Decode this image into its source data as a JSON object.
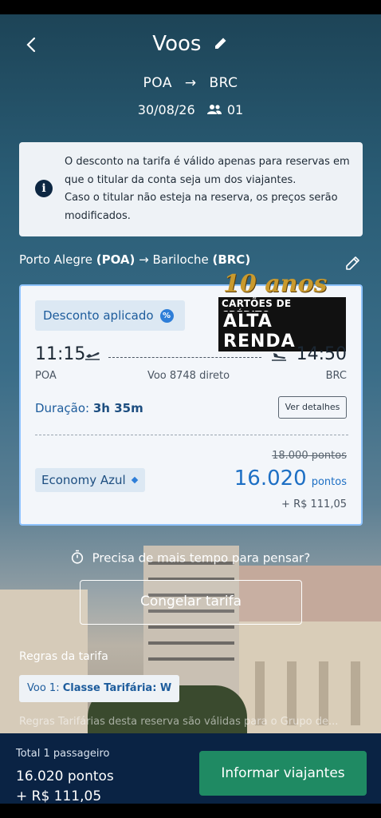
{
  "header": {
    "title": "Voos",
    "origin": "POA",
    "destination": "BRC",
    "date": "30/08/26",
    "passengers": "01"
  },
  "info": {
    "line1": "O desconto na tarifa é válido apenas para reservas em que o titular da conta seja um dos viajantes.",
    "line2": "Caso o titular não esteja na reserva, os preços serão modificados.",
    "icon": "info-icon"
  },
  "route_line": {
    "origin_city": "Porto Alegre",
    "origin_code": "(POA)",
    "dest_city": "Bariloche",
    "dest_code": "(BRC)"
  },
  "watermark": {
    "line1": "10 anos",
    "line2": "CARTÕES DE CRÉDITO",
    "line3": "ALTA RENDA"
  },
  "flight": {
    "discount_label": "Desconto aplicado",
    "departure_time": "11:15",
    "arrival_time": "14:50",
    "departure_code": "POA",
    "arrival_code": "BRC",
    "flight_info": "Voo 8748 direto",
    "duration_label": "Duração:",
    "duration_value": "3h 35m",
    "details_button": "Ver detalhes",
    "fare_class": "Economy Azul",
    "old_price": "18.000 pontos",
    "price_points": "16.020",
    "price_unit": "pontos",
    "tax": "+ R$ 111,05"
  },
  "actions": {
    "think_prompt": "Precisa de mais tempo para pensar?",
    "freeze_button": "Congelar tarifa"
  },
  "rules": {
    "title": "Regras da tarifa",
    "chip_prefix": "Voo 1: ",
    "chip_value": "Classe Tarifária: W",
    "faded_text": "Regras Tarifárias desta reserva são válidas para o Grupo de..."
  },
  "footer": {
    "total_label": "Total 1 passageiro",
    "total_points": "16.020 pontos",
    "total_money": "+ R$ 111,05",
    "cta_label": "Informar viajantes"
  },
  "colors": {
    "card_border": "#8ec3ff",
    "price_blue": "#1d6fc4",
    "cta_green": "#1f8a63",
    "footer_bg": "#0a2344"
  }
}
